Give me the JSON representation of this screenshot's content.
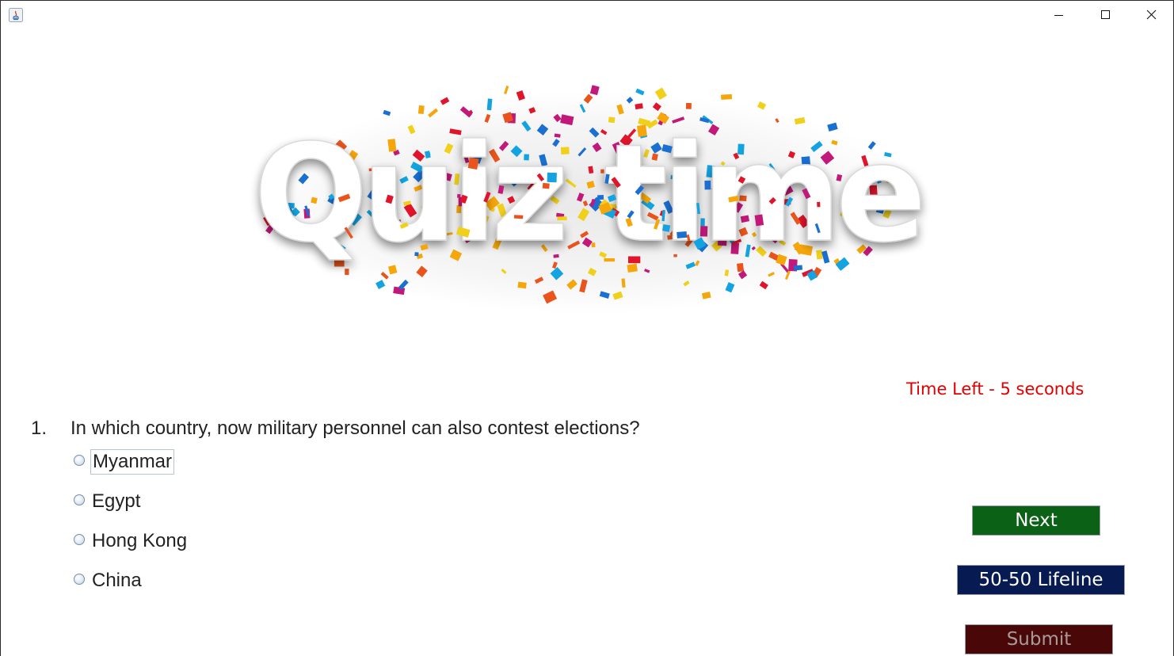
{
  "window": {
    "controls": [
      "minimize-icon",
      "maximize-icon",
      "close-icon"
    ]
  },
  "banner": {
    "logo_text": "Quiz time"
  },
  "timer": {
    "text": "Time Left - 5 seconds",
    "color": "#e00000"
  },
  "question": {
    "number": "1.",
    "text": "In which country, now military personnel can also contest elections?",
    "options": [
      "Myanmar",
      "Egypt",
      "Hong Kong",
      "China"
    ],
    "focused_option": "Myanmar"
  },
  "buttons": {
    "next": "Next",
    "lifeline": "50-50 Lifeline",
    "submit": "Submit"
  },
  "colors": {
    "next_bg": "#0b6116",
    "lifeline_bg": "#071a52",
    "submit_bg": "#4a0707",
    "timer": "#e00000"
  }
}
